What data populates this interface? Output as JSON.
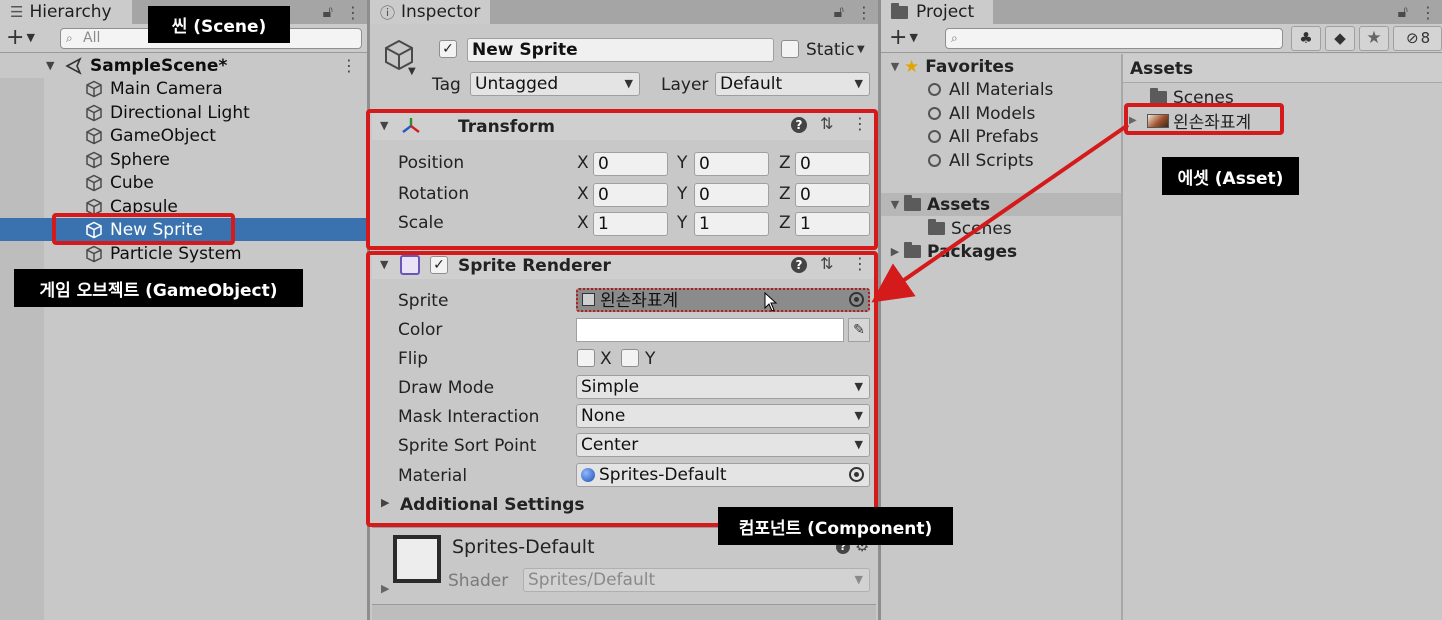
{
  "hierarchy": {
    "tab": "Hierarchy",
    "search_placeholder": "All",
    "scene": "SampleScene*",
    "items": [
      "Main Camera",
      "Directional Light",
      "GameObject",
      "Sphere",
      "Cube",
      "Capsule",
      "New Sprite",
      "Particle System"
    ],
    "selected_item": "New Sprite"
  },
  "inspector": {
    "tab": "Inspector",
    "object_name": "New Sprite",
    "static_label": "Static",
    "tag_label": "Tag",
    "tag_value": "Untagged",
    "layer_label": "Layer",
    "layer_value": "Default",
    "transform": {
      "title": "Transform",
      "rows": [
        {
          "label": "Position",
          "x": "0",
          "y": "0",
          "z": "0"
        },
        {
          "label": "Rotation",
          "x": "0",
          "y": "0",
          "z": "0"
        },
        {
          "label": "Scale",
          "x": "1",
          "y": "1",
          "z": "1"
        }
      ],
      "axis_x": "X",
      "axis_y": "Y",
      "axis_z": "Z"
    },
    "sprite_renderer": {
      "title": "Sprite Renderer",
      "sprite_label": "Sprite",
      "sprite_value": "왼손좌표계",
      "color_label": "Color",
      "flip_label": "Flip",
      "flip_x": "X",
      "flip_y": "Y",
      "draw_mode_label": "Draw Mode",
      "draw_mode_value": "Simple",
      "mask_label": "Mask Interaction",
      "mask_value": "None",
      "sort_label": "Sprite Sort Point",
      "sort_value": "Center",
      "material_label": "Material",
      "material_value": "Sprites-Default",
      "additional": "Additional Settings"
    },
    "material_preview": {
      "name": "Sprites-Default",
      "shader_label": "Shader",
      "shader_value": "Sprites/Default"
    }
  },
  "project": {
    "tab": "Project",
    "favorites_label": "Favorites",
    "favorites": [
      "All Materials",
      "All Models",
      "All Prefabs",
      "All Scripts"
    ],
    "assets_label": "Assets",
    "assets_children": [
      "Scenes"
    ],
    "packages_label": "Packages",
    "hidden_count": "8",
    "right_header": "Assets",
    "right_items": [
      "Scenes",
      "왼손좌표계"
    ]
  },
  "callouts": {
    "scene": "씬 (Scene)",
    "gameobject": "게임 오브젝트 (GameObject)",
    "asset": "에셋 (Asset)",
    "component": "컴포넌트 (Component)"
  },
  "colors": {
    "selection": "#3a72b0",
    "highlight_box": "#d41a1a",
    "callout_bg": "#000000"
  }
}
